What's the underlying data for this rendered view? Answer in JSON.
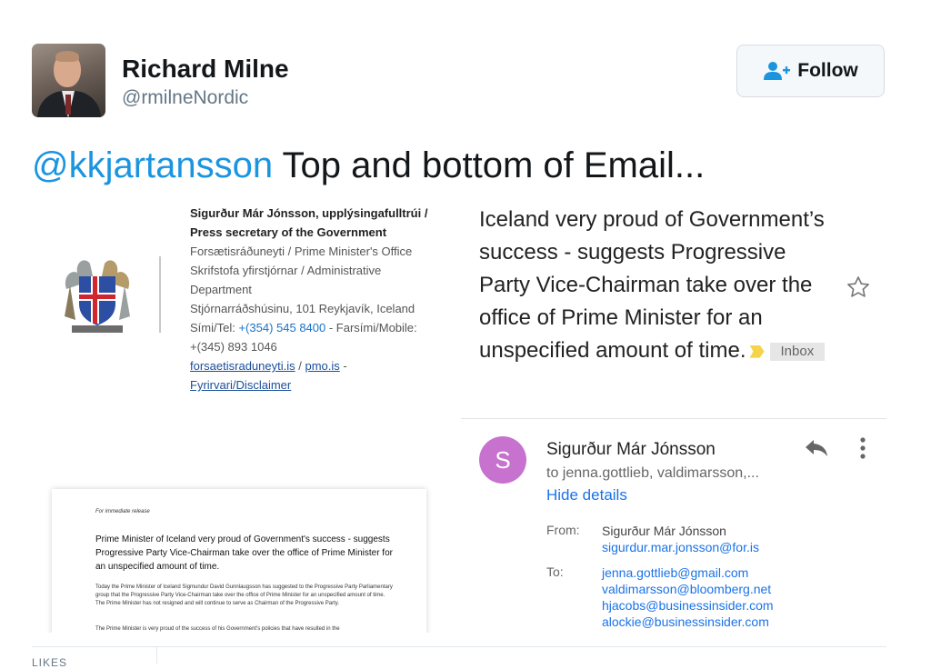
{
  "user": {
    "name": "Richard Milne",
    "handle": "@rmilneNordic"
  },
  "follow_button": {
    "label": "Follow",
    "icon": "follow-user-icon"
  },
  "tweet": {
    "mention": "@kkjartansson",
    "text": " Top and bottom of Email..."
  },
  "signature": {
    "name_line": "Sigurður Már Jónsson, upplýsingafulltrúi /",
    "title_line": "Press secretary of the Government",
    "office_line": "Forsætisráðuneyti / Prime Minister's Office",
    "department_line1": "Skrifstofa yfirstjórnar / Administrative",
    "department_line2": "Department",
    "address": "Stjórnarráðshúsinu, 101 Reykjavík, Iceland",
    "phone_label": "Sími/Tel: ",
    "phone": "+(354) 545 8400",
    "mobile_label": " - Farsími/Mobile:",
    "mobile": "+(345) 893 1046",
    "link1": "forsaetisraduneyti.is",
    "link_sep": " / ",
    "link2": "pmo.is",
    "link_dash": " -",
    "disclaimer": "Fyrirvari/Disclaimer"
  },
  "email": {
    "subject": "Iceland very proud of Government’s success - suggests Progressive Party Vice-Chairman take over the office of Prime Minister for an unspecified amount of time.",
    "label": "Inbox",
    "sender_initial": "S",
    "sender_name": "Sigurður Már Jónsson",
    "to_summary": "to jenna.gottlieb, valdimarsson,...",
    "hide_details": "Hide details",
    "from_label": "From:",
    "from_name": "Sigurður Már Jónsson",
    "from_email": "sigurdur.mar.jonsson@for.is",
    "to_label": "To:",
    "recipients": [
      "jenna.gottlieb@gmail.com",
      "valdimarsson@bloomberg.net",
      "hjacobs@businessinsider.com",
      "alockie@businessinsider.com"
    ]
  },
  "document": {
    "release_label": "For immediate release",
    "headline": "Prime Minister of Iceland very proud of Government's success - suggests Progressive Party Vice-Chairman take over the office of Prime Minister for an unspecified amount of time.",
    "paragraph": "Today the Prime Minister of Iceland Sigmundur David Gunnlaugsson has suggested to the Progressive Party Parliamentary group that the Progressive Party Vice-Chairman take over the office of Prime Minister for an unspecified amount of time. The Prime Minister has not resigned and will continue to serve as Chairman of the Progressive Party.",
    "paragraph2": "The Prime Minister is very proud of the success of his Government's policies that have resulted in the"
  },
  "footer": {
    "likes_label": "LIKES"
  },
  "colors": {
    "mention": "#1b95e0",
    "link": "#1a73e8",
    "sender_avatar": "#c772cf"
  }
}
